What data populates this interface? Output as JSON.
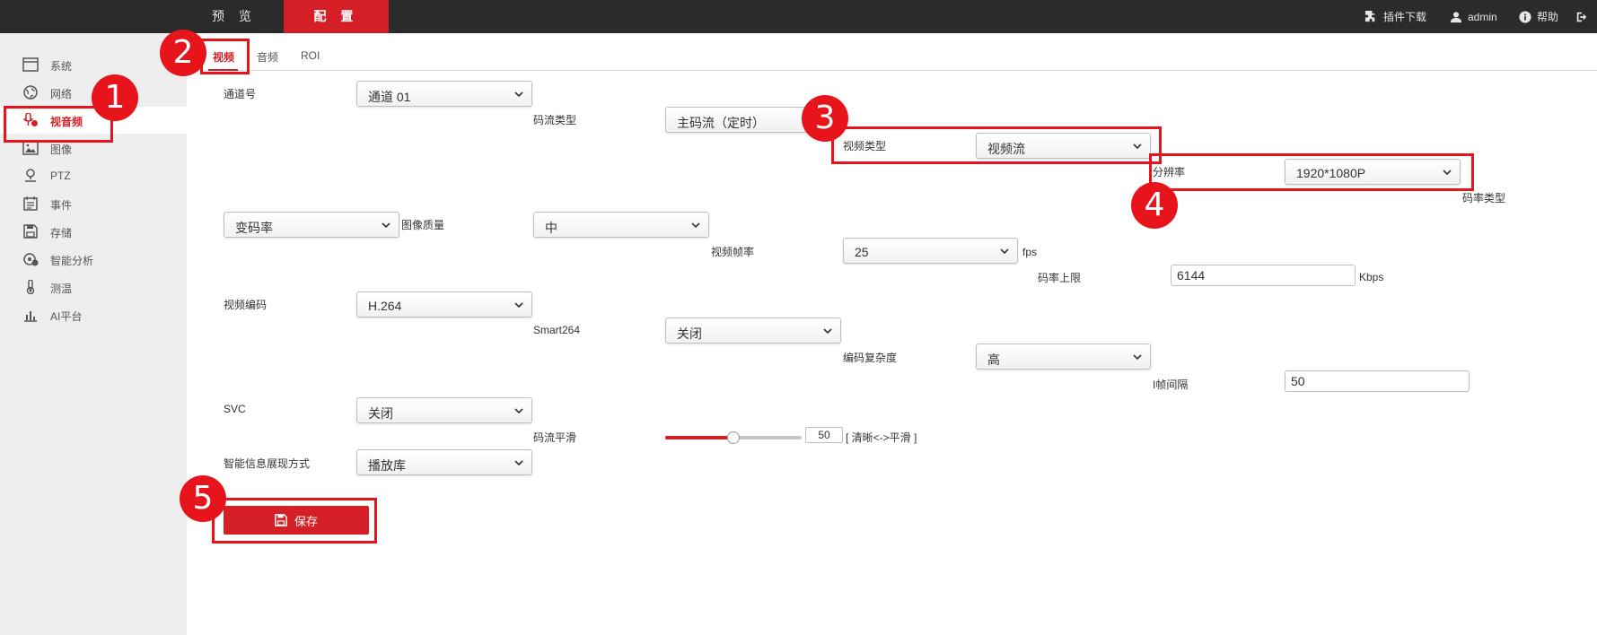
{
  "header": {
    "tabs": [
      {
        "label": "预 览",
        "active": false
      },
      {
        "label": "配 置",
        "active": true
      }
    ],
    "right": {
      "plugin_download": "插件下载",
      "user": "admin",
      "help": "帮助"
    }
  },
  "sidebar": {
    "items": [
      {
        "label": "系统",
        "icon": "system-icon",
        "active": false
      },
      {
        "label": "网络",
        "icon": "network-icon",
        "active": false
      },
      {
        "label": "视音频",
        "icon": "video-audio-icon",
        "active": true
      },
      {
        "label": "图像",
        "icon": "image-icon",
        "active": false
      },
      {
        "label": "PTZ",
        "icon": "ptz-icon",
        "active": false
      },
      {
        "label": "事件",
        "icon": "event-icon",
        "active": false
      },
      {
        "label": "存储",
        "icon": "storage-icon",
        "active": false
      },
      {
        "label": "智能分析",
        "icon": "smart-analysis-icon",
        "active": false
      },
      {
        "label": "测温",
        "icon": "thermometer-icon",
        "active": false
      },
      {
        "label": "AI平台",
        "icon": "ai-platform-icon",
        "active": false
      }
    ]
  },
  "subtabs": [
    {
      "label": "视频",
      "active": true
    },
    {
      "label": "音频",
      "active": false
    },
    {
      "label": "ROI",
      "active": false
    }
  ],
  "form": {
    "channel": {
      "label": "通道号",
      "value": "通道 01"
    },
    "stream_type": {
      "label": "码流类型",
      "value": "主码流（定时）"
    },
    "video_type": {
      "label": "视频类型",
      "value": "视频流"
    },
    "resolution": {
      "label": "分辨率",
      "value": "1920*1080P"
    },
    "bitrate_type": {
      "label": "码率类型",
      "value": "变码率"
    },
    "image_quality": {
      "label": "图像质量",
      "value": "中"
    },
    "frame_rate": {
      "label": "视频帧率",
      "value": "25",
      "unit": "fps"
    },
    "max_bitrate": {
      "label": "码率上限",
      "value": "6144",
      "unit": "Kbps"
    },
    "video_encoding": {
      "label": "视频编码",
      "value": "H.264"
    },
    "smart264": {
      "label": "Smart264",
      "value": "关闭"
    },
    "encoding_complexity": {
      "label": "编码复杂度",
      "value": "高"
    },
    "i_frame_interval": {
      "label": "I帧间隔",
      "value": "50"
    },
    "svc": {
      "label": "SVC",
      "value": "关闭"
    },
    "stream_smoothing": {
      "label": "码流平滑",
      "value": "50",
      "level": 0.5,
      "hint": "[ 清晰<->平滑 ]"
    },
    "smart_info_display": {
      "label": "智能信息展现方式",
      "value": "播放库"
    }
  },
  "save_button": {
    "label": "保存"
  },
  "annotations": [
    "1",
    "2",
    "3",
    "4",
    "5"
  ],
  "colors": {
    "accent": "#d51f26",
    "topbar": "#2b2b2b",
    "sidebar": "#eeeeee",
    "annotation": "#e8141c"
  }
}
